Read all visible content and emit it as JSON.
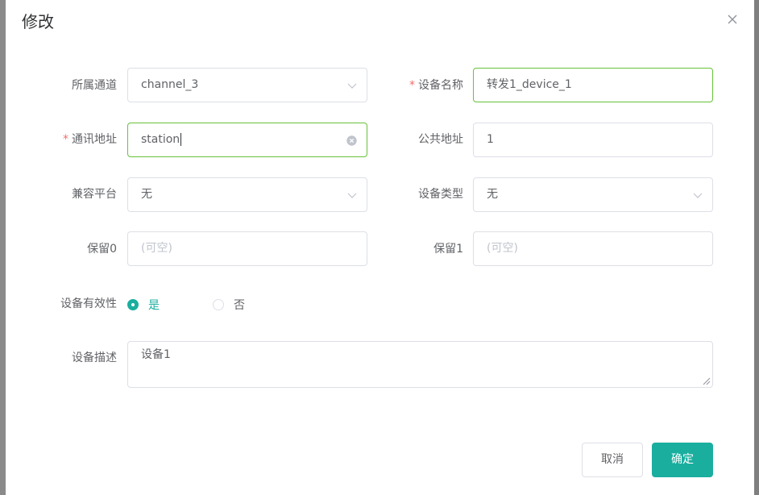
{
  "dialog": {
    "title": "修改",
    "close_icon": "close-icon"
  },
  "form": {
    "channel": {
      "label": "所属通道",
      "value": "channel_3"
    },
    "device_name": {
      "label": "设备名称",
      "required_mark": "*",
      "value": "转发1_device_1"
    },
    "comm_address": {
      "label": "通讯地址",
      "required_mark": "*",
      "value": "station"
    },
    "common_address": {
      "label": "公共地址",
      "value": "1"
    },
    "compat_platform": {
      "label": "兼容平台",
      "value": "无"
    },
    "device_type": {
      "label": "设备类型",
      "value": "无"
    },
    "reserved0": {
      "label": "保留0",
      "placeholder": "(可空)"
    },
    "reserved1": {
      "label": "保留1",
      "placeholder": "(可空)"
    },
    "validity": {
      "label": "设备有效性",
      "options": [
        {
          "label": "是",
          "checked": true
        },
        {
          "label": "否",
          "checked": false
        }
      ]
    },
    "description": {
      "label": "设备描述",
      "value": "设备1"
    }
  },
  "footer": {
    "cancel_label": "取消",
    "confirm_label": "确定"
  },
  "colors": {
    "accent": "#1aae9f",
    "focus_border": "#67c23a",
    "required": "#f56c6c"
  }
}
